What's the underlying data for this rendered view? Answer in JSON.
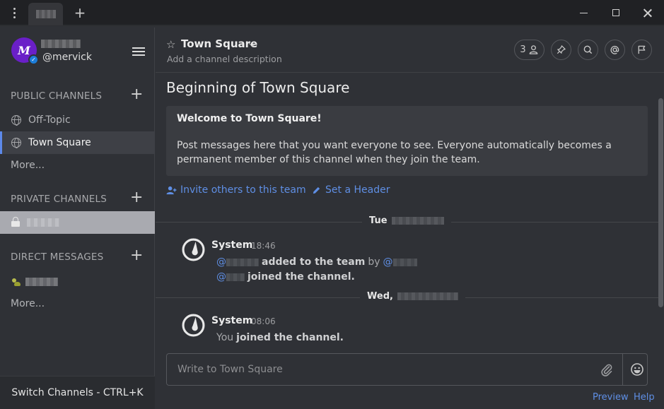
{
  "titlebar": {
    "new_tab": "+"
  },
  "user": {
    "avatar_letter": "M",
    "username": "@mervick"
  },
  "sidebar": {
    "public_title": "PUBLIC CHANNELS",
    "public_channels": [
      {
        "label": "Off-Topic"
      },
      {
        "label": "Town Square"
      }
    ],
    "public_more": "More...",
    "private_title": "PRIVATE CHANNELS",
    "dm_title": "DIRECT MESSAGES",
    "dm_more": "More...",
    "switch_label": "Switch Channels - CTRL+K"
  },
  "channel": {
    "title": "Town Square",
    "description": "Add a channel description",
    "member_count": "3"
  },
  "intro": {
    "heading": "Beginning of Town Square",
    "welcome_title": "Welcome to Town Square!",
    "welcome_text": "Post messages here that you want everyone to see. Everyone automatically becomes a permanent member of this channel when they join the team.",
    "invite_label": "Invite others to this team",
    "header_label": "Set a Header"
  },
  "feed": {
    "sep1": "Tue",
    "sep2": "Wed,",
    "post1": {
      "author": "System",
      "time": "18:46",
      "line1_prefix": "@",
      "line1_text": "added to the team",
      "line1_by": "by",
      "line1_suffix_at": "@",
      "line2_prefix": "@",
      "line2_text": "joined the channel."
    },
    "post2": {
      "author": "System",
      "time": "08:06",
      "you": "You",
      "text": "joined the channel."
    }
  },
  "composer": {
    "placeholder": "Write to Town Square"
  },
  "footer": {
    "preview": "Preview",
    "help": "Help"
  },
  "colors": {
    "accent": "#5f8fe5",
    "avatar": "#6a1fc8",
    "sidebar_bg": "#2f3136"
  },
  "icons": [
    "menu-dots-icon",
    "plus-icon",
    "minimize-icon",
    "maximize-icon",
    "close-icon",
    "hamburger-icon",
    "globe-icon",
    "lock-icon",
    "star-icon",
    "chevron-down-icon",
    "members-icon",
    "pin-icon",
    "search-icon",
    "at-icon",
    "flag-icon",
    "add-user-icon",
    "pencil-icon",
    "mattermost-logo-icon",
    "attachment-icon",
    "emoji-icon"
  ]
}
